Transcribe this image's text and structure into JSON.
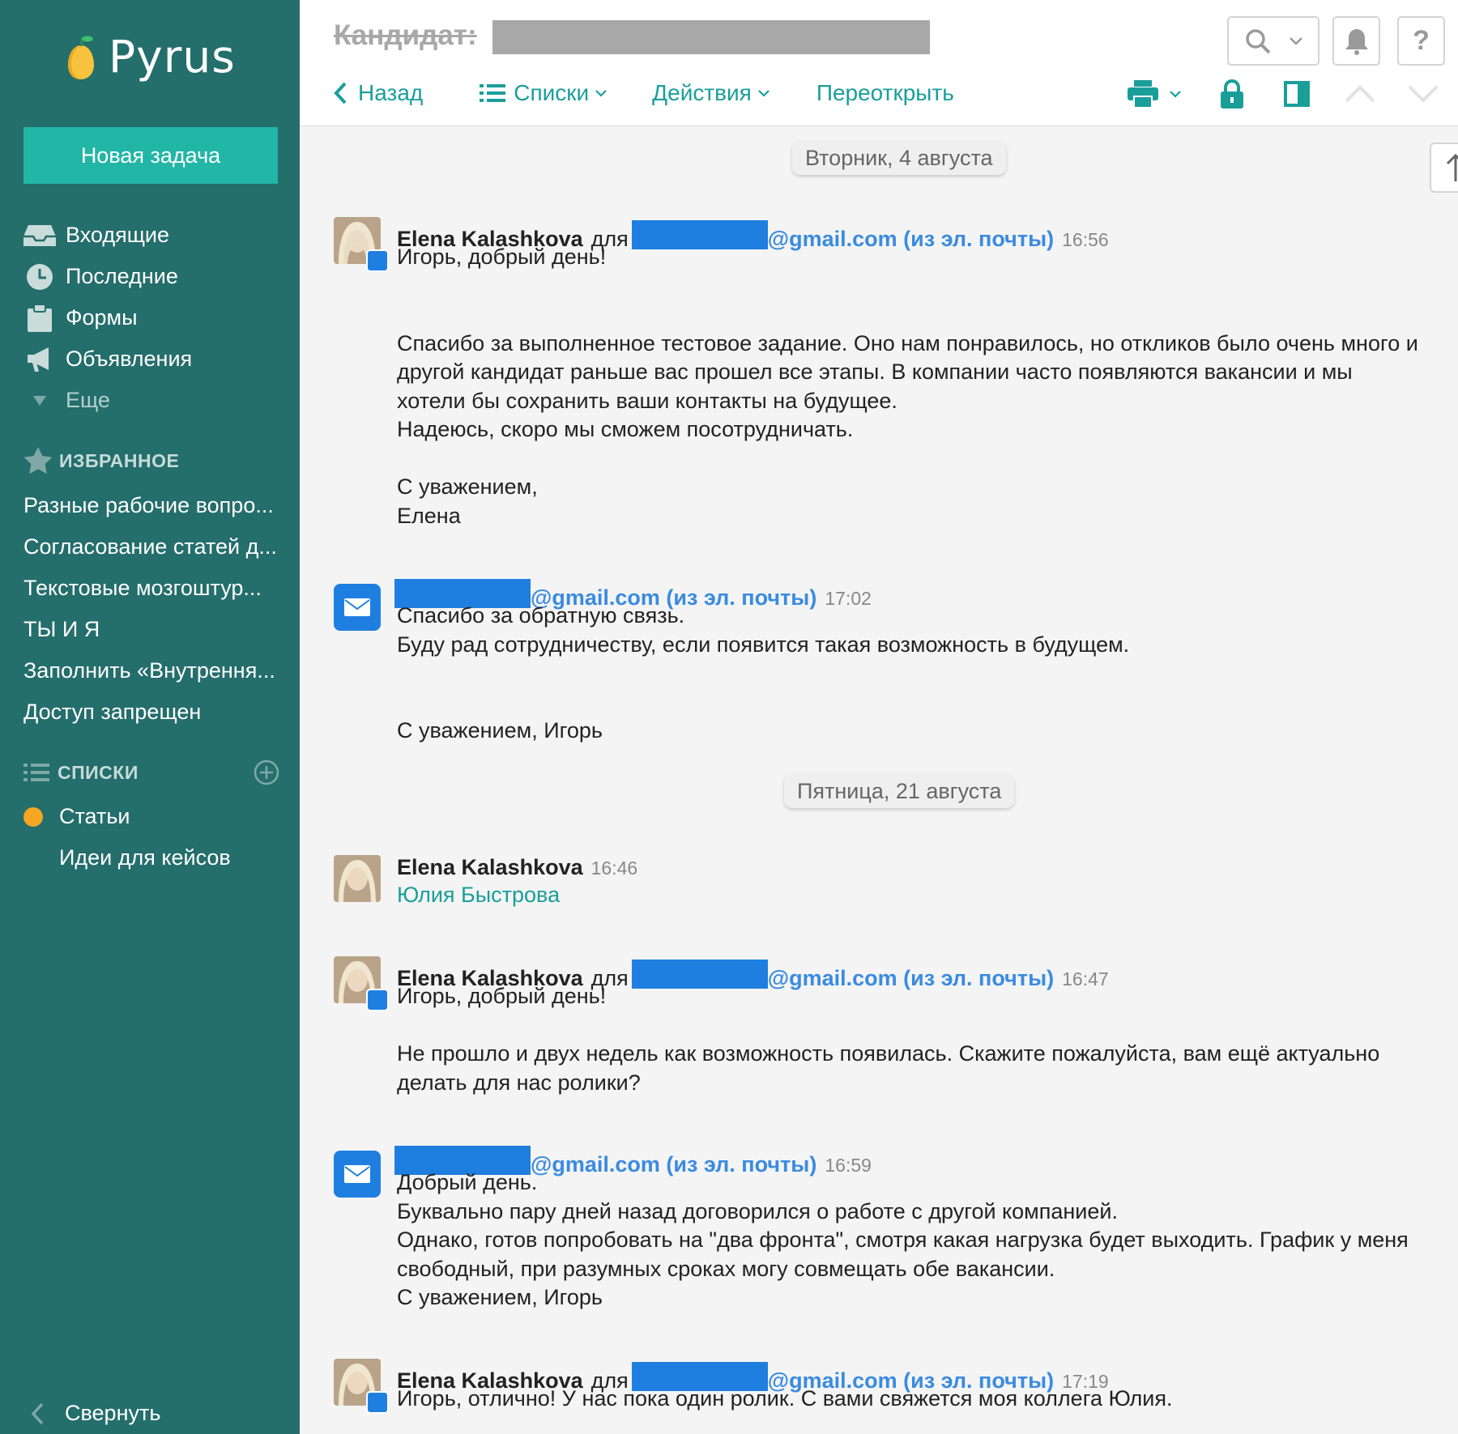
{
  "brand": {
    "name": "Pyrus"
  },
  "sidebar": {
    "new_task": "Новая задача",
    "nav": [
      {
        "label": "Входящие",
        "icon": "inbox-icon"
      },
      {
        "label": "Последние",
        "icon": "clock-icon"
      },
      {
        "label": "Формы",
        "icon": "clipboard-icon"
      },
      {
        "label": "Объявления",
        "icon": "megaphone-icon"
      },
      {
        "label": "Еще",
        "icon": "chevron-down-icon"
      }
    ],
    "favorites_title": "ИЗБРАННОЕ",
    "favorites": [
      "Разные рабочие вопро...",
      "Согласование статей д...",
      "Текстовые мозгоштур...",
      "ТЫ И Я",
      "Заполнить «Внутрення...",
      "Доступ запрещен"
    ],
    "lists_title": "СПИСКИ",
    "lists": [
      "Статьи",
      "Идеи для кейсов"
    ],
    "collapse": "Свернуть"
  },
  "header": {
    "title": "Кандидат:",
    "toolbar": {
      "back": "Назад",
      "lists": "Списки",
      "actions": "Действия",
      "reopen": "Переоткрыть"
    }
  },
  "feed": {
    "dates": [
      "Вторник, 4 августа",
      "Пятница, 21 августа"
    ],
    "messages": [
      {
        "author": "Elena Kalashkova",
        "to_word": "для",
        "email": "@gmail.com (из эл. почты)",
        "time": "16:56",
        "body": "Игорь, добрый день!\n\n\nСпасибо за выполненное тестовое задание. Оно нам понравилось, но откликов было очень много и\nдругой кандидат раньше вас прошел все этапы. В компании часто появляются вакансии и мы\nхотели бы сохранить ваши контакты на будущее.\nНадеюсь, скоро мы сможем посотрудничать.\n\nС уважением,\nЕлена"
      },
      {
        "email": "@gmail.com (из эл. почты)",
        "time": "17:02",
        "body": "Спасибо за обратную связь.\nБуду рад сотрудничеству, если появится такая возможность в будущем.\n\n\nС уважением, Игорь"
      },
      {
        "author": "Elena Kalashkova",
        "time": "16:46",
        "mention": "Юлия Быстрова"
      },
      {
        "author": "Elena Kalashkova",
        "to_word": "для",
        "email": "@gmail.com (из эл. почты)",
        "time": "16:47",
        "body": "Игорь, добрый день!\n\nНе прошло и двух недель как возможность появилась. Скажите пожалуйста, вам ещё актуально\nделать для нас ролики?"
      },
      {
        "email": "@gmail.com (из эл. почты)",
        "time": "16:59",
        "body": "Добрый день.\nБуквально пару дней назад договорился о работе с другой компанией.\nОднако, готов попробовать на \"два фронта\", смотря какая нагрузка будет выходить. График у меня\nсвободный, при разумных сроках могу совмещать обе вакансии.\nС уважением, Игорь"
      },
      {
        "author": "Elena Kalashkova",
        "to_word": "для",
        "email": "@gmail.com (из эл. почты)",
        "time": "17:19",
        "body": "Игорь, отлично! У нас пока один ролик. С вами свяжется моя коллега Юлия."
      }
    ]
  },
  "colors": {
    "sidebar": "#246e6c",
    "accent": "#22b6a6",
    "link": "#1a9e9a",
    "email": "#3a8be0",
    "redaction": "#1f7fe0",
    "favorite_dot": "#f5a623"
  }
}
